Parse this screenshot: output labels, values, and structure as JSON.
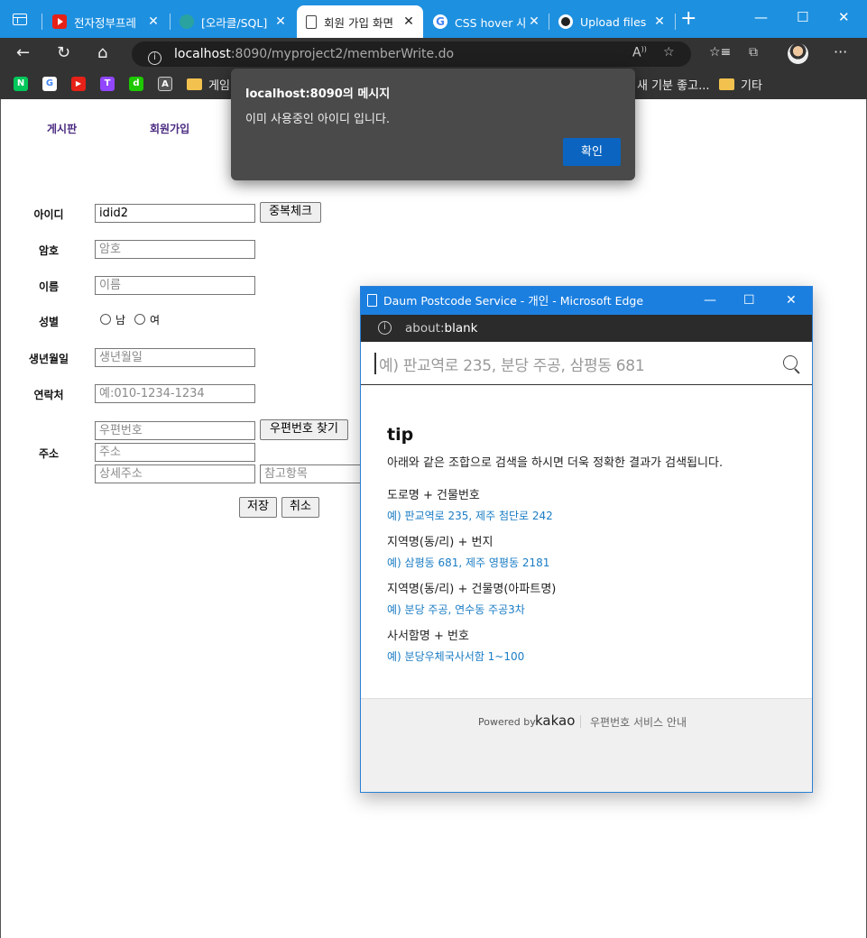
{
  "browser": {
    "tabs": [
      {
        "label": "전자정부프레",
        "close": "✕"
      },
      {
        "label": "[오라클/SQL] (",
        "close": "✕"
      },
      {
        "label": "회원 가입 화면",
        "close": "✕"
      },
      {
        "label": "CSS hover 사용",
        "close": "✕"
      },
      {
        "label": "Upload files ·",
        "close": "✕"
      }
    ],
    "new_tab": "+",
    "url_host": "localhost",
    "url_path": ":8090/myproject2/memberWrite.do",
    "bookmarks": [
      {
        "icon": "N",
        "color": "#03c75a"
      },
      {
        "icon": "G",
        "color": "#ffffff"
      },
      {
        "icon": "▶",
        "color": "#e62117"
      },
      {
        "icon": "T",
        "color": "#9146ff"
      },
      {
        "icon": "d",
        "color": "#1ec800"
      },
      {
        "icon": "A",
        "color": "#555555"
      }
    ],
    "bookmark_folders": [
      "게임",
      "새 기분 좋고...",
      "기타"
    ]
  },
  "page": {
    "nav": [
      "게시판",
      "회원가입"
    ],
    "form": {
      "id_label": "아이디",
      "id_value": "idid2",
      "dup_check_button": "중복체크",
      "pw_label": "암호",
      "pw_placeholder": "암호",
      "name_label": "이름",
      "name_placeholder": "이름",
      "gender_label": "성별",
      "gender_male": "남",
      "gender_female": "여",
      "birth_label": "생년월일",
      "birth_placeholder": "생년월일",
      "phone_label": "연락처",
      "phone_placeholder": "예:010-1234-1234",
      "addr_label": "주소",
      "zip_placeholder": "우편번호",
      "zip_button": "우편번호 찾기",
      "addr_placeholder": "주소",
      "addr_detail_placeholder": "상세주소",
      "addr_extra_placeholder": "참고항목",
      "save_button": "저장",
      "cancel_button": "취소"
    }
  },
  "alert": {
    "title": "localhost:8090의 메시지",
    "message": "이미 사용중인 아이디 입니다.",
    "ok": "확인"
  },
  "popup": {
    "title": "Daum Postcode Service - 개인 - Microsoft Edge",
    "url_prefix": "about:",
    "url_main": "blank",
    "search_placeholder": "예) 판교역로 235, 분당 주공, 삼평동 681",
    "tip_title": "tip",
    "tip_desc": "아래와 같은 조합으로 검색을 하시면 더욱 정확한 결과가 검색됩니다.",
    "tips": [
      {
        "head": "도로명 + 건물번호",
        "example": "예) 판교역로 235,  제주 첨단로 242"
      },
      {
        "head": "지역명(동/리) + 번지",
        "example": "예) 삼평동 681,  제주 영평동 2181"
      },
      {
        "head": "지역명(동/리) + 건물명(아파트명)",
        "example": "예) 분당 주공,  연수동 주공3차"
      },
      {
        "head": "사서함명 + 번호",
        "example": "예) 분당우체국사서함 1~100"
      }
    ],
    "powered_by": "Powered by",
    "kakao": "kakao",
    "guide": "우편번호 서비스 안내"
  },
  "colors": {
    "tabbar": "#1e90e0",
    "popup_titlebar": "#1b7fe0",
    "alert_ok": "#0a64c0",
    "tip_example": "#1a7cc4"
  }
}
